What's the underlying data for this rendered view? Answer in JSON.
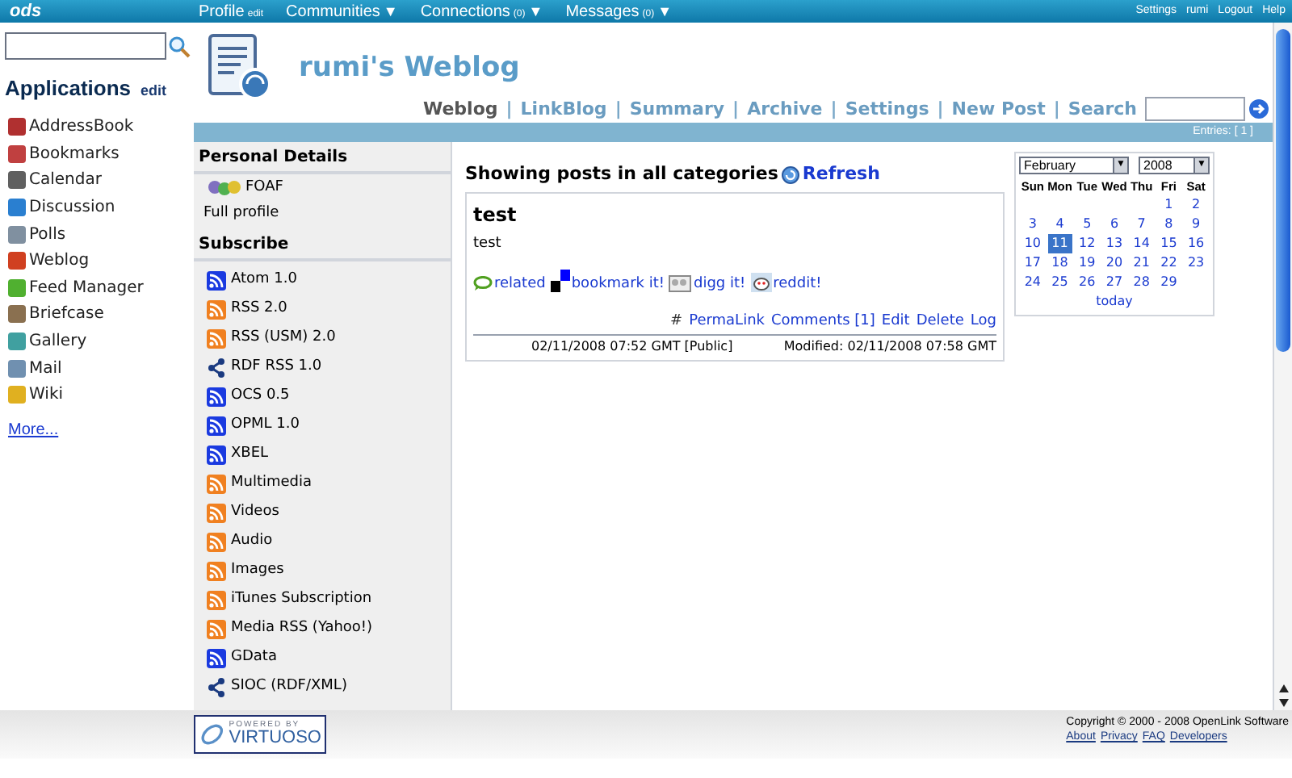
{
  "top_bar": {
    "logo": "ods",
    "menu": [
      {
        "label": "Profile",
        "extra": "edit"
      },
      {
        "label": "Communities",
        "caret": "▼"
      },
      {
        "label": "Connections",
        "count": "(0)",
        "caret": "▼"
      },
      {
        "label": "Messages",
        "count": "(0)",
        "caret": "▼"
      }
    ],
    "links": [
      "Settings",
      "rumi",
      "Logout",
      "Help"
    ]
  },
  "sidebar": {
    "title": "Applications",
    "edit": "edit",
    "items": [
      {
        "label": "AddressBook",
        "color": "#b03030"
      },
      {
        "label": "Bookmarks",
        "color": "#c04040"
      },
      {
        "label": "Calendar",
        "color": "#606060"
      },
      {
        "label": "Discussion",
        "color": "#2a7fd0"
      },
      {
        "label": "Polls",
        "color": "#8090a0"
      },
      {
        "label": "Weblog",
        "color": "#d04020"
      },
      {
        "label": "Feed Manager",
        "color": "#50b030"
      },
      {
        "label": "Briefcase",
        "color": "#8a7050"
      },
      {
        "label": "Gallery",
        "color": "#40a0a0"
      },
      {
        "label": "Mail",
        "color": "#7090b0"
      },
      {
        "label": "Wiki",
        "color": "#e0b020"
      }
    ],
    "more": "More..."
  },
  "blog": {
    "title": "rumi's Weblog",
    "nav": [
      {
        "label": "Weblog",
        "selected": true
      },
      {
        "label": "LinkBlog",
        "selected": false
      },
      {
        "label": "Summary",
        "selected": false
      },
      {
        "label": "Archive",
        "selected": false
      },
      {
        "label": "Settings",
        "selected": false
      },
      {
        "label": "New Post",
        "selected": false
      },
      {
        "label": "Search",
        "selected": false
      }
    ],
    "separator": "|",
    "entries": "Entries: [ 1 ]"
  },
  "left_panel": {
    "personal_title": "Personal Details",
    "foaf": "FOAF",
    "full_profile": "Full profile",
    "subscribe_title": "Subscribe",
    "feeds": [
      {
        "label": "Atom 1.0",
        "kind": "blue"
      },
      {
        "label": "RSS 2.0",
        "kind": "orange"
      },
      {
        "label": "RSS (USM) 2.0",
        "kind": "orange"
      },
      {
        "label": "RDF RSS 1.0",
        "kind": "rdf"
      },
      {
        "label": "OCS 0.5",
        "kind": "blue"
      },
      {
        "label": "OPML 1.0",
        "kind": "blue"
      },
      {
        "label": "XBEL",
        "kind": "blue"
      },
      {
        "label": "Multimedia",
        "kind": "orange"
      },
      {
        "label": "Videos",
        "kind": "orange"
      },
      {
        "label": "Audio",
        "kind": "orange"
      },
      {
        "label": "Images",
        "kind": "orange"
      },
      {
        "label": "iTunes Subscription",
        "kind": "orange"
      },
      {
        "label": "Media RSS (Yahoo!)",
        "kind": "orange"
      },
      {
        "label": "GData",
        "kind": "blue"
      },
      {
        "label": "SIOC (RDF/XML)",
        "kind": "rdf"
      }
    ]
  },
  "posts_heading": "Showing posts in all categories",
  "refresh": "Refresh",
  "post": {
    "title": "test",
    "body": "test",
    "actions": [
      {
        "label": "related",
        "kind": "comment"
      },
      {
        "label": "bookmark it!",
        "kind": "squares"
      },
      {
        "label": "digg it!",
        "kind": "digg"
      },
      {
        "label": "reddit!",
        "kind": "reddit"
      }
    ],
    "hash": "#",
    "links": [
      "PermaLink",
      "Comments [1]",
      "Edit",
      "Delete",
      "Log"
    ],
    "posted": "02/11/2008 07:52 GMT [Public]",
    "modified": "Modified: 02/11/2008 07:58 GMT"
  },
  "calendar": {
    "month": "February",
    "month_caret": "▼",
    "year": "2008",
    "year_caret": "▼",
    "weekdays": [
      "Sun",
      "Mon",
      "Tue",
      "Wed",
      "Thu",
      "Fri",
      "Sat"
    ],
    "weeks": [
      {
        "days": [
          {
            "day": "1",
            "selected": false
          },
          {
            "day": "2",
            "selected": false
          }
        ]
      },
      {
        "days": [
          {
            "day": "3",
            "selected": false
          },
          {
            "day": "4",
            "selected": false
          },
          {
            "day": "5",
            "selected": false
          },
          {
            "day": "6",
            "selected": false
          },
          {
            "day": "7",
            "selected": false
          },
          {
            "day": "8",
            "selected": false
          },
          {
            "day": "9",
            "selected": false
          }
        ]
      },
      {
        "days": [
          {
            "day": "10",
            "selected": false
          },
          {
            "day": "11",
            "selected": true
          },
          {
            "day": "12",
            "selected": false
          },
          {
            "day": "13",
            "selected": false
          },
          {
            "day": "14",
            "selected": false
          },
          {
            "day": "15",
            "selected": false
          },
          {
            "day": "16",
            "selected": false
          }
        ]
      },
      {
        "days": [
          {
            "day": "17",
            "selected": false
          },
          {
            "day": "18",
            "selected": false
          },
          {
            "day": "19",
            "selected": false
          },
          {
            "day": "20",
            "selected": false
          },
          {
            "day": "21",
            "selected": false
          },
          {
            "day": "22",
            "selected": false
          },
          {
            "day": "23",
            "selected": false
          }
        ]
      },
      {
        "days": [
          {
            "day": "24",
            "selected": false
          },
          {
            "day": "25",
            "selected": false
          },
          {
            "day": "26",
            "selected": false
          },
          {
            "day": "27",
            "selected": false
          },
          {
            "day": "28",
            "selected": false
          },
          {
            "day": "29",
            "selected": false
          }
        ]
      }
    ],
    "today": "today"
  },
  "footer": {
    "powered": "POWERED BY",
    "brand": "VIRTUOSO",
    "copyright": "Copyright © 2000 - 2008 OpenLink Software",
    "links": [
      "About",
      "Privacy",
      "FAQ",
      "Developers"
    ]
  }
}
